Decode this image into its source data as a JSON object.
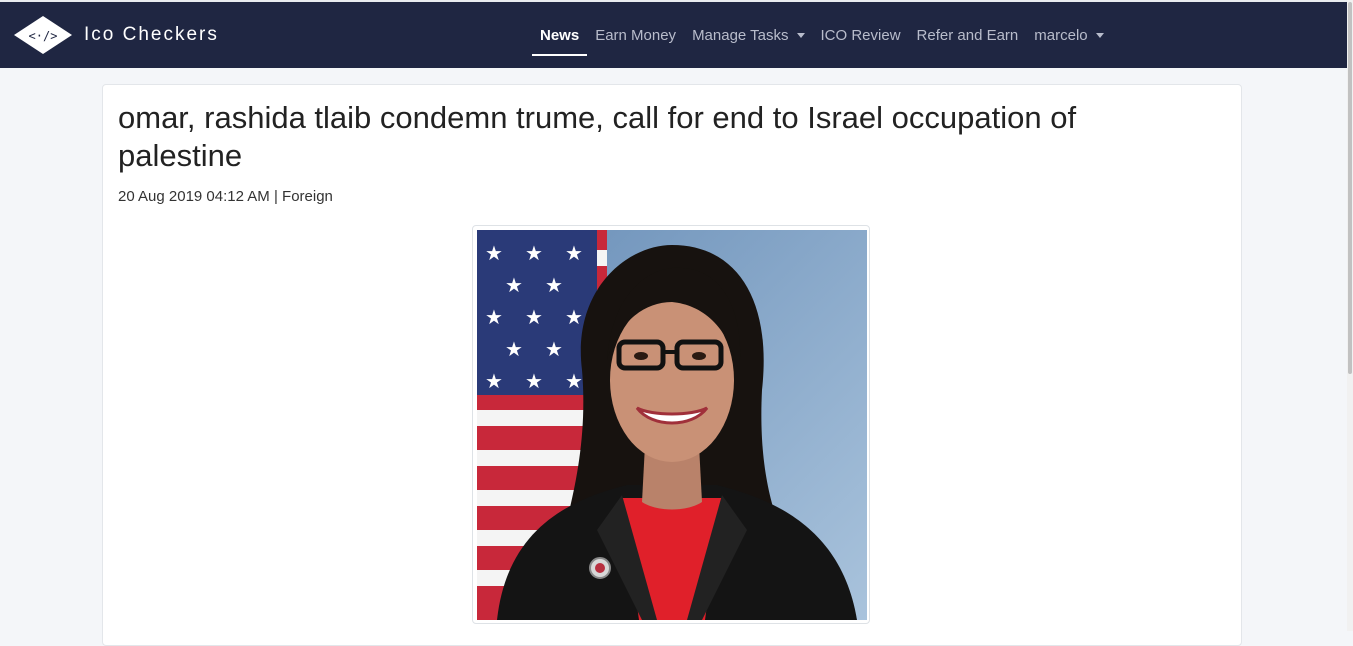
{
  "brand": {
    "name": "Ico Checkers",
    "logo_glyph": "<·/>"
  },
  "nav": {
    "items": [
      {
        "label": "News",
        "active": true,
        "dropdown": false
      },
      {
        "label": "Earn Money",
        "active": false,
        "dropdown": false
      },
      {
        "label": "Manage Tasks",
        "active": false,
        "dropdown": true
      },
      {
        "label": "ICO Review",
        "active": false,
        "dropdown": false
      },
      {
        "label": "Refer and Earn",
        "active": false,
        "dropdown": false
      },
      {
        "label": "marcelo",
        "active": false,
        "dropdown": true
      }
    ]
  },
  "article": {
    "title": "omar, rashida tlaib condemn trume, call for end to Israel occupation of palestine",
    "meta": "20 Aug 2019 04:12 AM | Foreign"
  },
  "colors": {
    "navbar": "#1f2642",
    "page_bg": "#f4f6f9",
    "shirt": "#e0202a"
  }
}
